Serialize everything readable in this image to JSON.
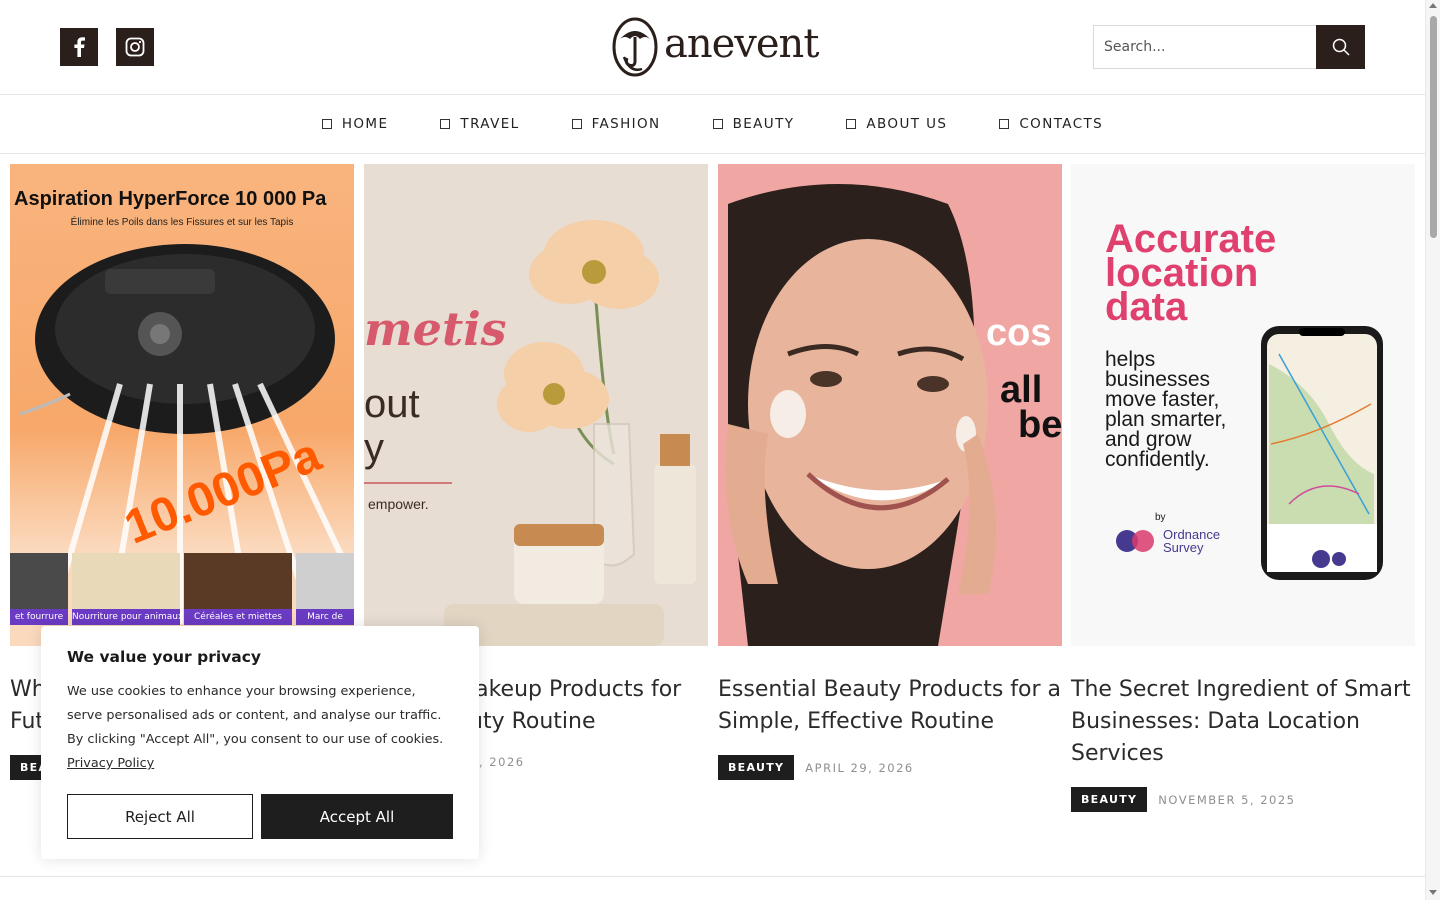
{
  "brand": {
    "logo_text": "anevent"
  },
  "search": {
    "placeholder": "Search..."
  },
  "nav": {
    "items": [
      {
        "label": "HOME"
      },
      {
        "label": "TRAVEL"
      },
      {
        "label": "FASHION"
      },
      {
        "label": "BEAUTY"
      },
      {
        "label": "ABOUT US"
      },
      {
        "label": "CONTACTS"
      }
    ]
  },
  "cards": [
    {
      "title": "Wh\nFut",
      "badge": "BEAUTY",
      "date": "",
      "image": {
        "headline": "Aspiration HyperForce 10 000 Pa",
        "sub": "Élimine les Poils dans les Fissures et sur les Tapis",
        "big": "10.000Pa",
        "tiles": [
          "et fourrure",
          "Nourriture pour animaux",
          "Céréales et miettes",
          "Marc de"
        ]
      }
    },
    {
      "title": "lakeup Products for\nuty Routine",
      "badge": "",
      "date": ", 2026",
      "image": {
        "brand": "metis",
        "line1": "out",
        "line2": "y",
        "line3": "empower."
      }
    },
    {
      "title": "Essential Beauty Products for a Simple, Effective Routine",
      "badge": "BEAUTY",
      "date": "APRIL 29, 2026",
      "image": {
        "brand": "cos",
        "line1": "all",
        "line2": "be"
      }
    },
    {
      "title": "The Secret Ingredient of Smart Businesses: Data Location Services",
      "badge": "BEAUTY",
      "date": "NOVEMBER 5, 2025",
      "image": {
        "headline": "Accurate location data",
        "body": "helps businesses move faster, plan smarter, and grow confidently.",
        "by": "by",
        "sponsor": "Ordnance Survey"
      }
    }
  ],
  "cookie": {
    "title": "We value your privacy",
    "body": "We use cookies to enhance your browsing experience, serve personalised ads or content, and analyse our traffic. By clicking \"Accept All\", you consent to our use of cookies.",
    "link": "Privacy Policy",
    "reject": "Reject All",
    "accept": "Accept All"
  },
  "colors": {
    "dark": "#2a1f1b",
    "badge": "#1e1e1e",
    "pink": "#e0406e",
    "peach": "#f7b07a"
  },
  "icons": [
    "facebook-icon",
    "instagram-icon",
    "search-icon"
  ]
}
